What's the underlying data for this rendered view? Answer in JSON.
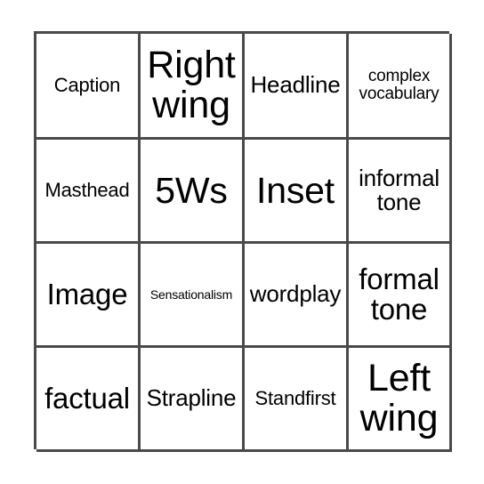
{
  "card": {
    "columns": 4,
    "rows": 4,
    "border_color": "#4a4a4a",
    "background_color": "#ffffff",
    "text_color": "#000000",
    "cells": [
      {
        "text": "Caption",
        "size": "sm"
      },
      {
        "text": "Right wing",
        "size": "xxl"
      },
      {
        "text": "Headline",
        "size": "md"
      },
      {
        "text": "complex vocabulary",
        "size": "xs"
      },
      {
        "text": "Masthead",
        "size": "sm"
      },
      {
        "text": "5Ws",
        "size": "xl"
      },
      {
        "text": "Inset",
        "size": "xl"
      },
      {
        "text": "informal tone",
        "size": "md"
      },
      {
        "text": "Image",
        "size": "lg"
      },
      {
        "text": "Sensationalism",
        "size": "xxs"
      },
      {
        "text": "wordplay",
        "size": "md"
      },
      {
        "text": "formal tone",
        "size": "lg"
      },
      {
        "text": "factual",
        "size": "lg"
      },
      {
        "text": "Strapline",
        "size": "md"
      },
      {
        "text": "Standfirst",
        "size": "sm"
      },
      {
        "text": "Left wing",
        "size": "xxl"
      }
    ]
  }
}
